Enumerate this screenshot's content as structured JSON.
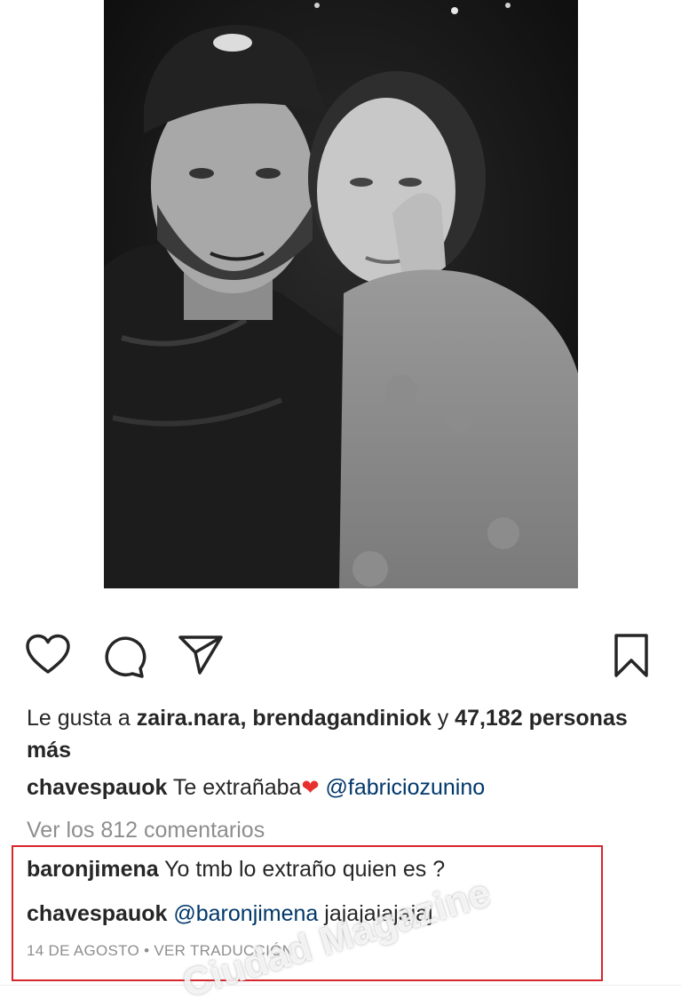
{
  "post": {
    "likes": {
      "prefix": "Le gusta a",
      "user1": "zaira.nara,",
      "user2": "brendagandiniok",
      "middle": "y",
      "count": "47,182",
      "suffix": "personas más"
    },
    "caption": {
      "username": "chavespauok",
      "text": "Te extrañaba",
      "emoji": "❤",
      "mention": "@fabriciozunino"
    },
    "view_comments": "Ver los 812 comentarios",
    "comments": [
      {
        "username": "baronjimena",
        "text": "Yo tmb lo extraño quien es ?"
      },
      {
        "username": "chavespauok",
        "mention": "@baronjimena",
        "text": "jajajajajajaj"
      }
    ],
    "date": "14 DE AGOSTO",
    "separator": "•",
    "translate": "VER TRADUCCIÓN"
  },
  "watermark": "Ciudad Magazine",
  "icons": [
    "heart-icon",
    "comment-icon",
    "share-icon",
    "bookmark-icon"
  ],
  "colors": {
    "mention": "#00376b",
    "highlight_border": "#d8262d",
    "muted": "#8e8e8e",
    "heart": "#e8302c"
  }
}
